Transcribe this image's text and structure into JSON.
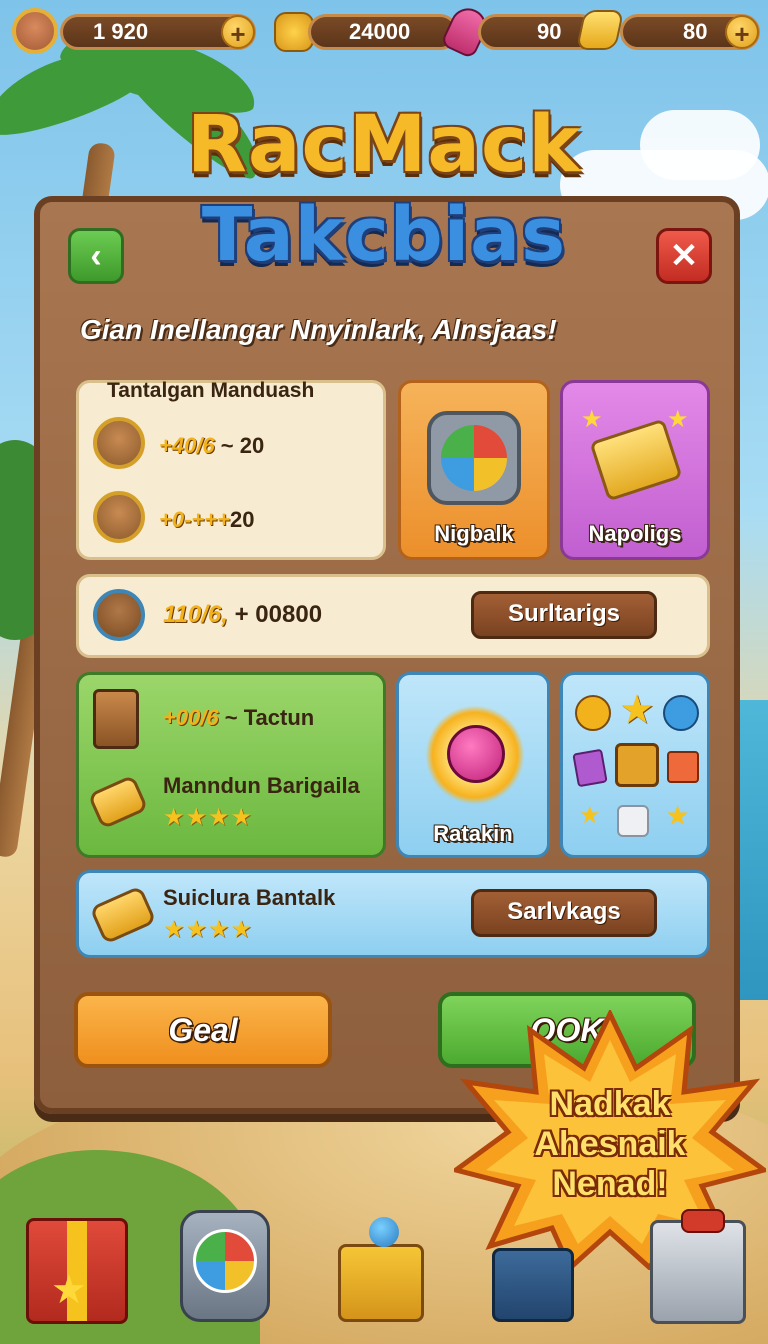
{
  "topbar": {
    "lives": "1  920",
    "coins": "24000",
    "boosters": "90",
    "gems": "80",
    "plus": "+",
    "icons": [
      "avatar-icon",
      "coin-bag-icon",
      "rocket-icon",
      "bolt-icon"
    ]
  },
  "title": {
    "line1": "RacMack",
    "line2": "Takcbias"
  },
  "subtitle": "Gian Inellangar Nnyinlark, Alnsjaas!",
  "nav": {
    "back": "‹",
    "close": "✕"
  },
  "card1": {
    "heading": "Tantalgan Manduash",
    "row1_bonus": "+40/6",
    "row1_rest": " ~ 20",
    "row2_bonus": "+0-+++",
    "row2_rest": "20"
  },
  "card2": {
    "label": "Nigbalk"
  },
  "card3": {
    "label": "Napoligs"
  },
  "strip1": {
    "bonus": "110/6,",
    "value": "+ 00800",
    "button": "Surltarigs"
  },
  "card4": {
    "bonus": "+00/6",
    "rest": " ~ Tactun",
    "name": "Manndun Barigaila",
    "stars": "★★★★"
  },
  "card5": {
    "label": "Ratakin"
  },
  "strip2": {
    "name": "Suiclura Bantalk",
    "stars": "★★★★",
    "button": "Sarlvkags"
  },
  "buttons": {
    "cancel": "Geal",
    "ok": "OOK"
  },
  "burst": {
    "line1": "Nadkak",
    "line2": "Ahesnaik",
    "line3": "Nenad!"
  },
  "colors": {
    "accent_gold": "#f2b21b",
    "panel": "#a87650",
    "ok_green": "#4caa30",
    "cancel_orange": "#ef8f1e"
  }
}
